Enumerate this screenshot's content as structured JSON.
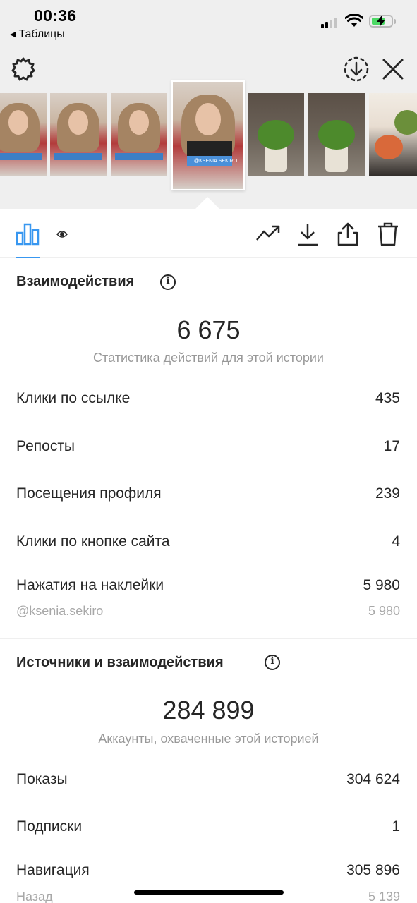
{
  "status_bar": {
    "time": "00:36",
    "back_app": "Таблицы",
    "back_arrow_icon": "triangle-left-icon",
    "signal_icon": "cellular-signal-icon",
    "wifi_icon": "wifi-icon",
    "battery_icon": "battery-charging-icon",
    "battery_color": "#4cd964"
  },
  "toolbar": {
    "settings_icon": "gear-icon",
    "download_icon": "download-circle-icon",
    "close_icon": "close-icon"
  },
  "thumbnails": {
    "selected_caption": "@KSENIA.SEKIRO"
  },
  "tabs": {
    "insights_icon": "bar-chart-icon",
    "viewers_icon": "eye-icon",
    "accent": "#3897f0"
  },
  "actions": {
    "promote_icon": "trending-up-icon",
    "save_icon": "download-icon",
    "share_icon": "share-icon",
    "delete_icon": "trash-icon"
  },
  "interactions": {
    "title": "Взаимодействия",
    "info_icon": "info-icon",
    "total": "6 675",
    "subtitle": "Статистика действий для этой истории",
    "rows": [
      {
        "label": "Клики по ссылке",
        "value": "435"
      },
      {
        "label": "Репосты",
        "value": "17"
      },
      {
        "label": "Посещения профиля",
        "value": "239"
      },
      {
        "label": "Клики по кнопке сайта",
        "value": "4"
      },
      {
        "label": "Нажатия на наклейки",
        "value": "5 980"
      }
    ],
    "sticker_sub": {
      "label": "@ksenia.sekiro",
      "value": "5 980"
    }
  },
  "discovery": {
    "title": "Источники и взаимодействия",
    "info_icon": "info-icon",
    "total": "284 899",
    "subtitle": "Аккаунты, охваченные этой историей",
    "rows": [
      {
        "label": "Показы",
        "value": "304 624"
      },
      {
        "label": "Подписки",
        "value": "1"
      },
      {
        "label": "Навигация",
        "value": "305 896"
      }
    ],
    "nav_sub": {
      "label": "Назад",
      "value": "5 139"
    }
  }
}
